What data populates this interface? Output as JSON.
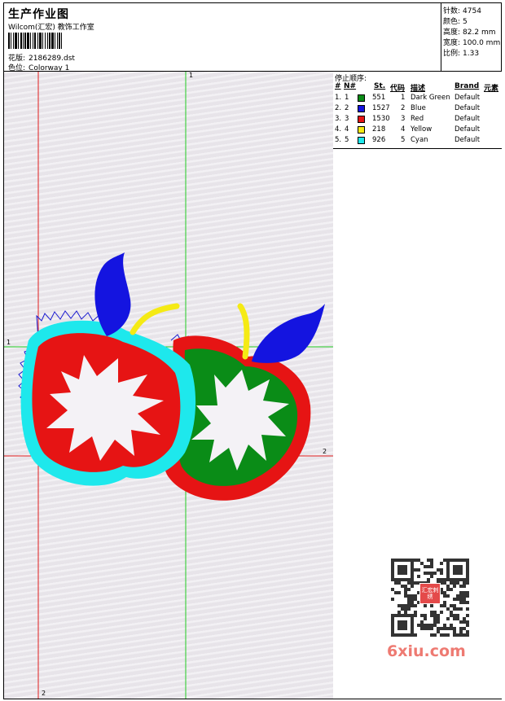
{
  "header": {
    "title": "生产作业图",
    "subtitle": "Wilcom(汇宏) 教饰工作室",
    "design_label": "花版:",
    "design_value": "2186289.dst",
    "colorway_label": "色位:",
    "colorway_value": "Colorway 1"
  },
  "stats": [
    {
      "label": "针数:",
      "value": "4754"
    },
    {
      "label": "颜色:",
      "value": "5"
    },
    {
      "label": "高度:",
      "value": "82.2 mm"
    },
    {
      "label": "宽度:",
      "value": "100.0 mm"
    },
    {
      "label": "比例:",
      "value": "1.33"
    }
  ],
  "stop_sequence": {
    "title": "停止顺序:",
    "columns": [
      "#",
      "N#",
      "St.",
      "代码",
      "描述",
      "Brand",
      "元素"
    ],
    "rows": [
      {
        "index": "1.",
        "n": "1",
        "color": "#0a8c17",
        "st": "551",
        "code": "1",
        "desc": "Dark Green",
        "brand": "Default"
      },
      {
        "index": "2.",
        "n": "2",
        "color": "#1414e0",
        "st": "1527",
        "code": "2",
        "desc": "Blue",
        "brand": "Default"
      },
      {
        "index": "3.",
        "n": "3",
        "color": "#e61414",
        "st": "1530",
        "code": "3",
        "desc": "Red",
        "brand": "Default"
      },
      {
        "index": "4.",
        "n": "4",
        "color": "#f5ea14",
        "st": "218",
        "code": "4",
        "desc": "Yellow",
        "brand": "Default"
      },
      {
        "index": "5.",
        "n": "5",
        "color": "#1ee8ec",
        "st": "926",
        "code": "5",
        "desc": "Cyan",
        "brand": "Default"
      }
    ]
  },
  "axes": {
    "green_v_label": "1",
    "green_h_label": "1",
    "red_h_label": "2",
    "red_v_label": "2"
  },
  "colors": {
    "green_guide": "#22cc22",
    "red_guide": "#e01e1e",
    "outline_blue": "#1a1ad0"
  },
  "watermark": {
    "seal_text": "汇宏刺绣",
    "site": "6xiu.com"
  }
}
